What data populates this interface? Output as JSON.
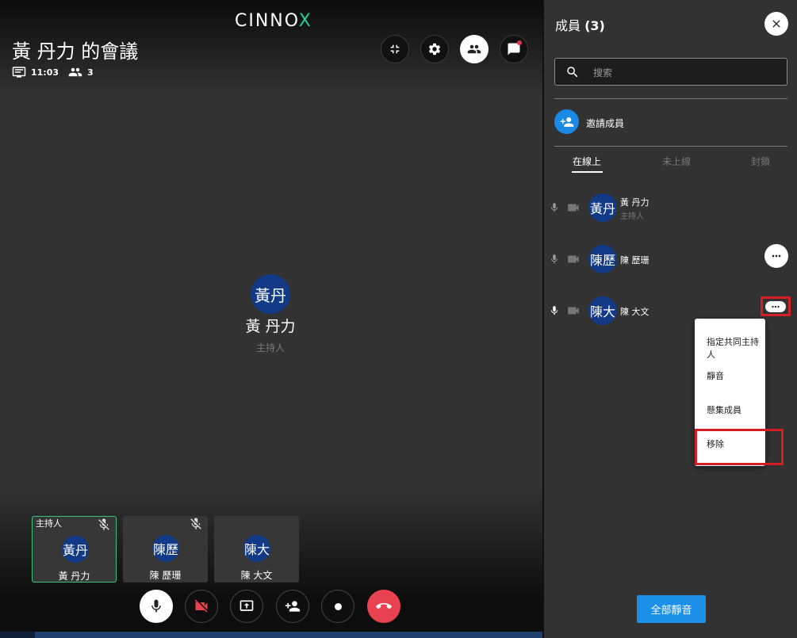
{
  "logo": {
    "main": "CINNO",
    "accent": "X",
    "accent_color": "#1ed0a0"
  },
  "meeting": {
    "title": "黃 丹力 的會議",
    "time": "11:03",
    "participant_count": "3"
  },
  "top_controls": [
    {
      "icon": "collapse-icon"
    },
    {
      "icon": "settings-icon"
    },
    {
      "icon": "people-icon",
      "active": true
    },
    {
      "icon": "chat-flag-icon",
      "has_notification": true
    }
  ],
  "stage": {
    "avatar_text": "黃丹",
    "name": "黃 丹力",
    "role": "主持人"
  },
  "tiles": [
    {
      "tag": "主持人",
      "avatar_text": "黃丹",
      "name": "黃 丹力",
      "muted": true,
      "active": true
    },
    {
      "tag": "",
      "avatar_text": "陳歷",
      "name": "陳 歷珊",
      "muted": true,
      "active": false
    },
    {
      "tag": "",
      "avatar_text": "陳大",
      "name": "陳 大文",
      "muted": false,
      "active": false
    }
  ],
  "controls": [
    {
      "name": "microphone-button",
      "icon": "mic-icon"
    },
    {
      "name": "camera-button",
      "icon": "camera-off-icon"
    },
    {
      "name": "share-screen-button",
      "icon": "screen-share-icon"
    },
    {
      "name": "add-person-button",
      "icon": "person-add-icon"
    },
    {
      "name": "record-button",
      "icon": "record-icon"
    },
    {
      "name": "hang-up-button",
      "icon": "phone-hangup-icon",
      "color": "#e8414f"
    }
  ],
  "panel": {
    "title": "成員",
    "count": "(3)",
    "search_placeholder": "搜索",
    "invite_label": "邀請成員",
    "tabs": [
      "在線上",
      "未上線",
      "封鎖"
    ],
    "members": [
      {
        "avatar_text": "黃丹",
        "name": "黃 丹力",
        "role": "主持人"
      },
      {
        "avatar_text": "陳歷",
        "name": "陳 歷珊",
        "role": ""
      },
      {
        "avatar_text": "陳大",
        "name": "陳 大文",
        "role": ""
      }
    ],
    "menu": [
      "指定共同主持人",
      "靜音",
      "懸集成員",
      "移除"
    ],
    "mute_all": "全部靜音"
  },
  "colors": {
    "accent_blue": "#1c8fe8",
    "avatar_blue": "#123a86",
    "highlight_red": "#d42024",
    "active_tile_border": "#3cc27d"
  }
}
